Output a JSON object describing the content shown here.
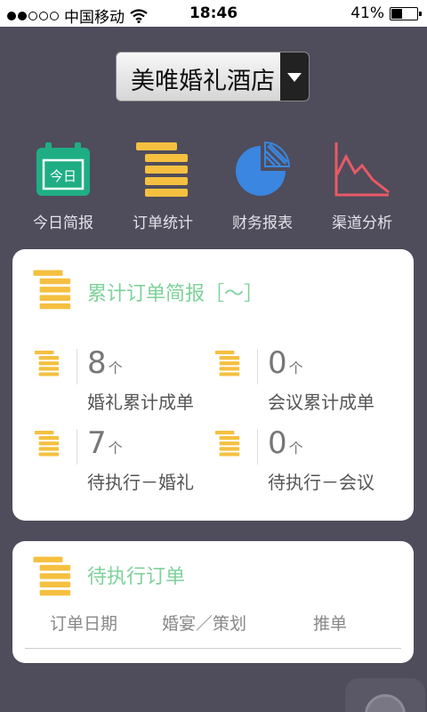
{
  "status": {
    "carrier": "中国移动",
    "time": "18:46",
    "battery": "41%",
    "battery_level": 0.41
  },
  "selector": {
    "value": "美唯婚礼酒店"
  },
  "nav": [
    {
      "label": "今日简报",
      "icon": "calendar-today-icon",
      "calendar_text": "今日"
    },
    {
      "label": "订单统计",
      "icon": "stack-icon"
    },
    {
      "label": "财务报表",
      "icon": "pie-chart-icon"
    },
    {
      "label": "渠道分析",
      "icon": "line-chart-icon"
    }
  ],
  "summary": {
    "title": "累计订单简报［～］",
    "unit": "个",
    "stats": [
      {
        "value": "8",
        "label": "婚礼累计成单"
      },
      {
        "value": "0",
        "label": "会议累计成单"
      },
      {
        "value": "7",
        "label": "待执行－婚礼"
      },
      {
        "value": "0",
        "label": "待执行－会议"
      }
    ]
  },
  "pending": {
    "title": "待执行订单",
    "columns": [
      "订单日期",
      "婚宴／策划",
      "推单"
    ]
  },
  "colors": {
    "background": "#4f4c5b",
    "accent_green": "#7ed29a",
    "stack_yellow": "#f5c040",
    "calendar_green": "#1fae84",
    "pie_blue": "#3a86e0",
    "line_red": "#e85a66"
  }
}
